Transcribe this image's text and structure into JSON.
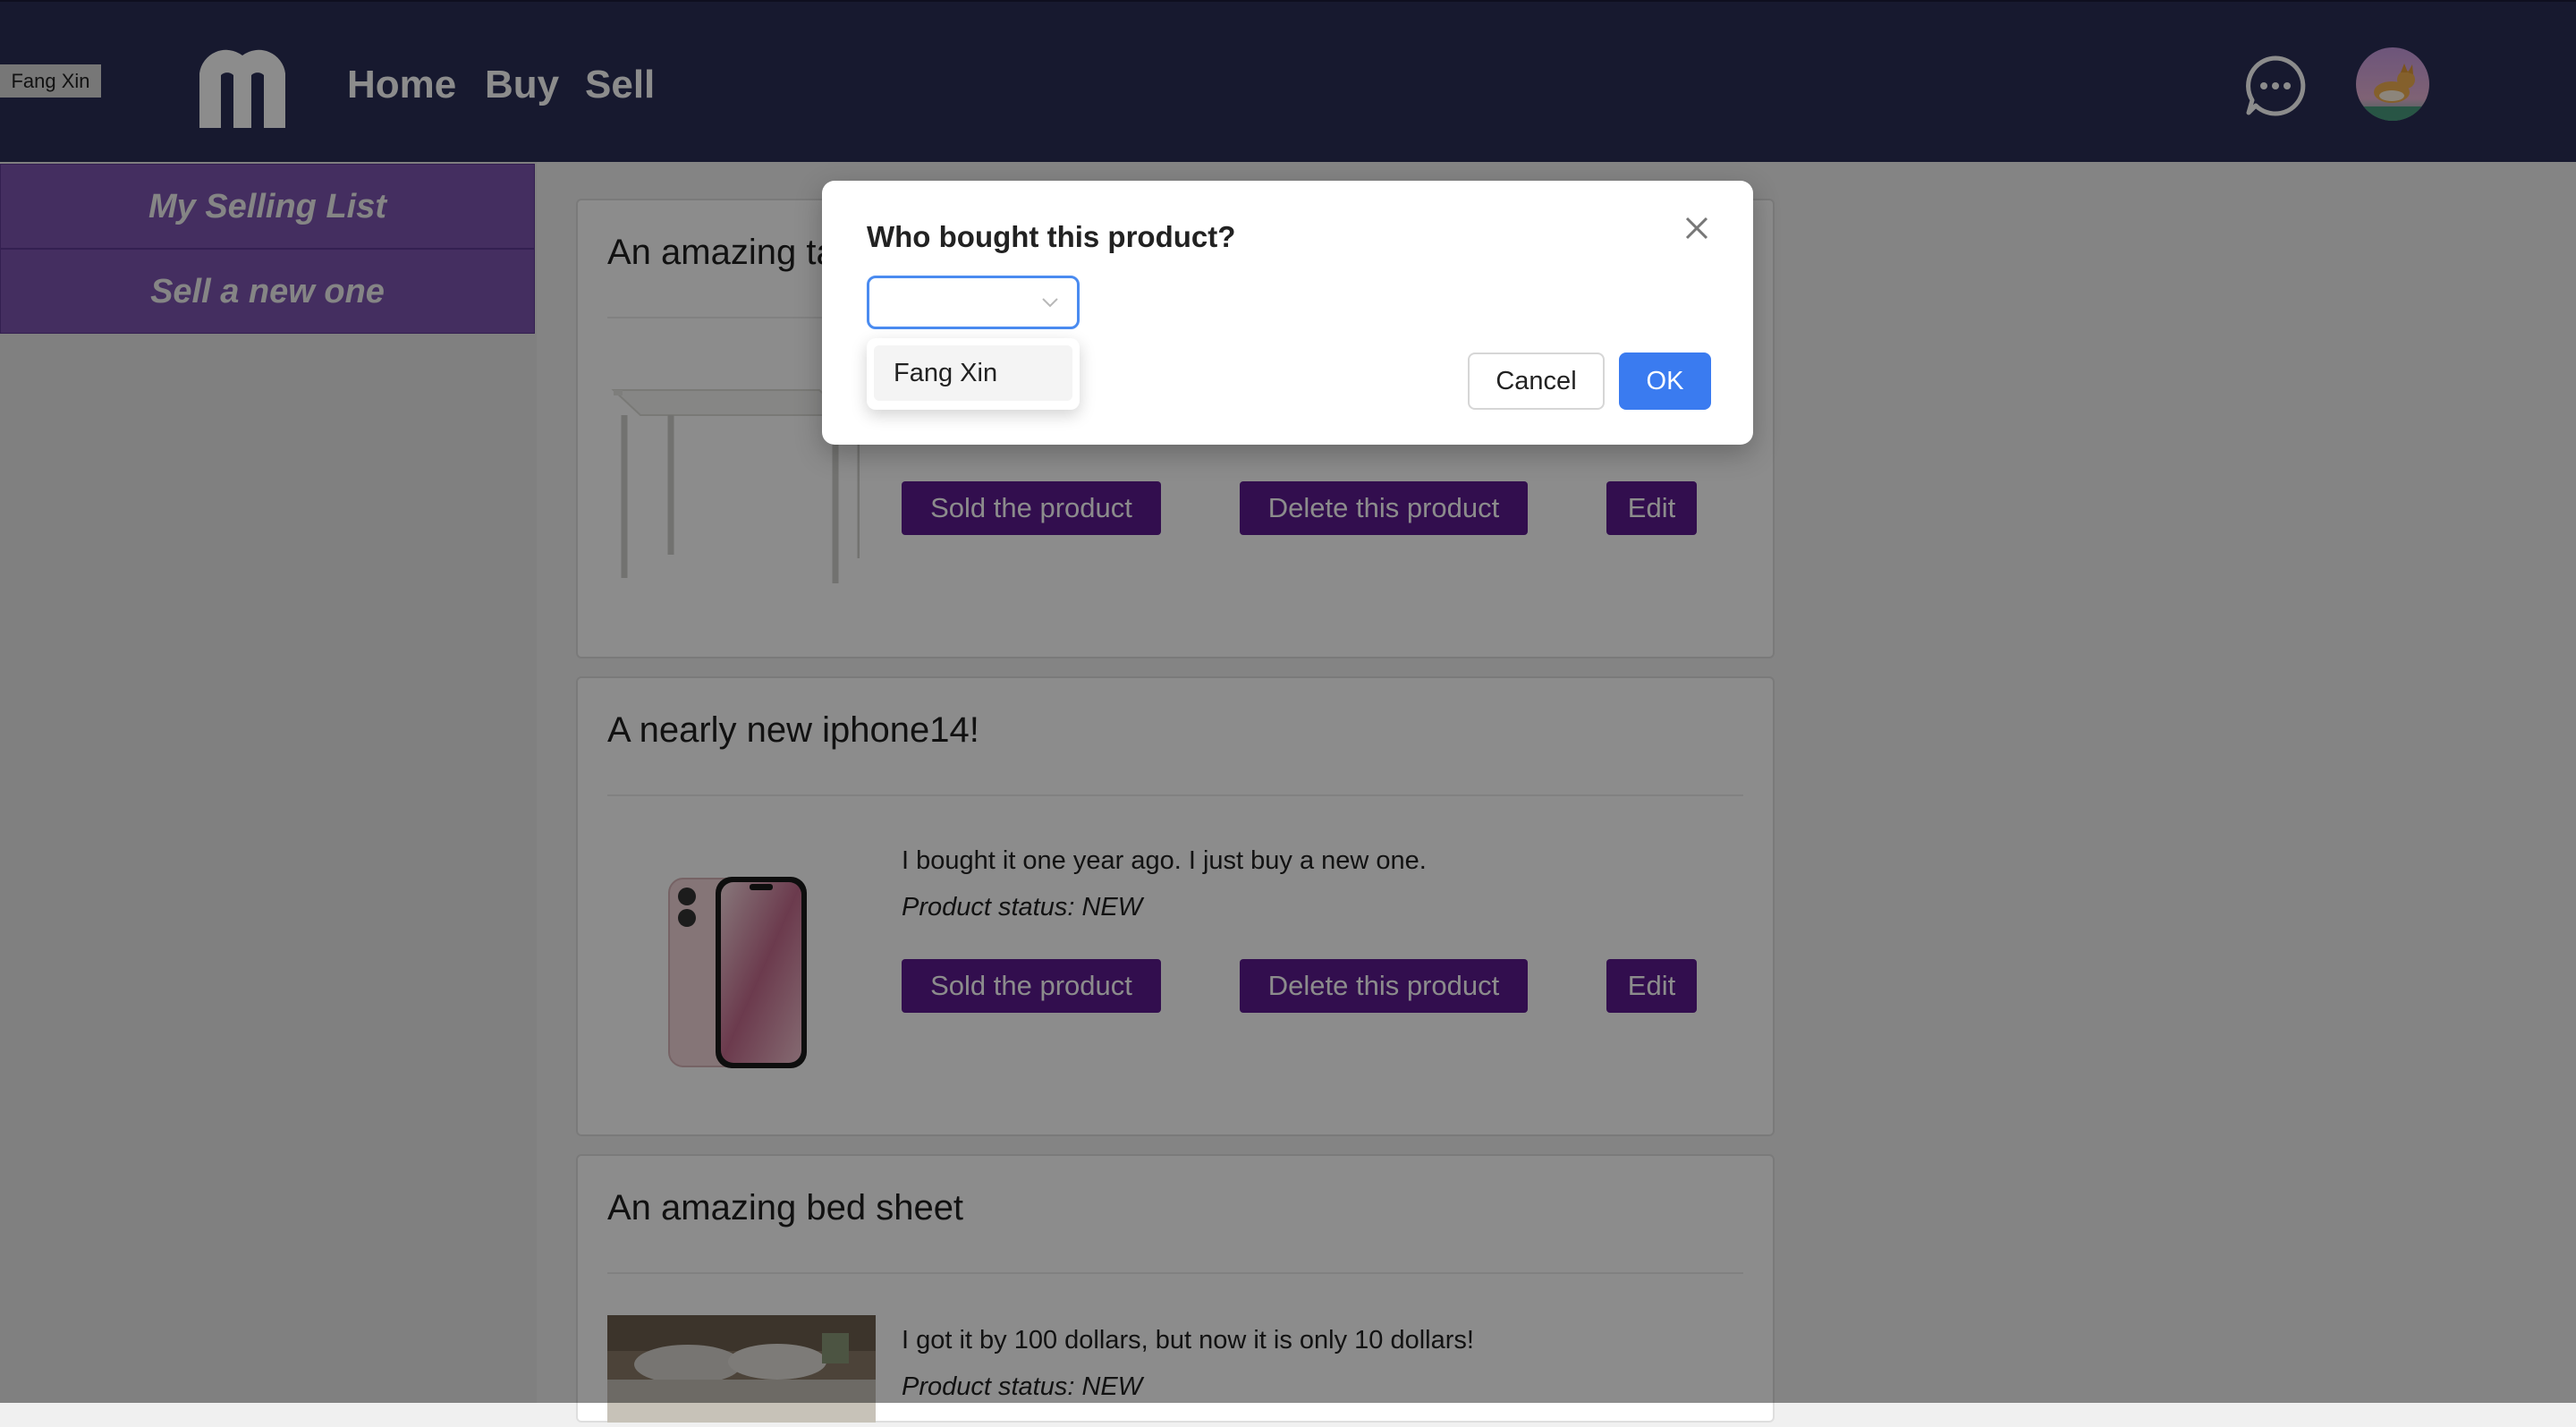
{
  "user_tag": "Fang Xin",
  "nav": {
    "home": "Home",
    "buy": "Buy",
    "sell": "Sell"
  },
  "icons": {
    "logo": "m-logo-icon",
    "chat": "chat-bubble-icon",
    "avatar": "corgi-avatar"
  },
  "sidebar": {
    "items": [
      {
        "label": "My Selling List"
      },
      {
        "label": "Sell a new one"
      }
    ]
  },
  "products": [
    {
      "title": "An amazing ta",
      "sold_label": "Sold the product",
      "delete_label": "Delete this product",
      "edit_label": "Edit"
    },
    {
      "title": "A nearly new iphone14!",
      "description": "I bought it one year ago. I just buy a new one.",
      "status": "Product status: NEW",
      "sold_label": "Sold the product",
      "delete_label": "Delete this product",
      "edit_label": "Edit"
    },
    {
      "title": "An amazing bed sheet",
      "description": "I got it by 100 dollars, but now it is only 10 dollars!",
      "status": "Product status: NEW"
    }
  ],
  "modal": {
    "title": "Who bought this product?",
    "select_value": "",
    "options": [
      "Fang Xin"
    ],
    "cancel_label": "Cancel",
    "ok_label": "OK"
  },
  "colors": {
    "header": "#2b2f57",
    "sidebar_item": "#7d55b0",
    "action_button": "#5b1a8f",
    "primary": "#3a7bf0"
  }
}
